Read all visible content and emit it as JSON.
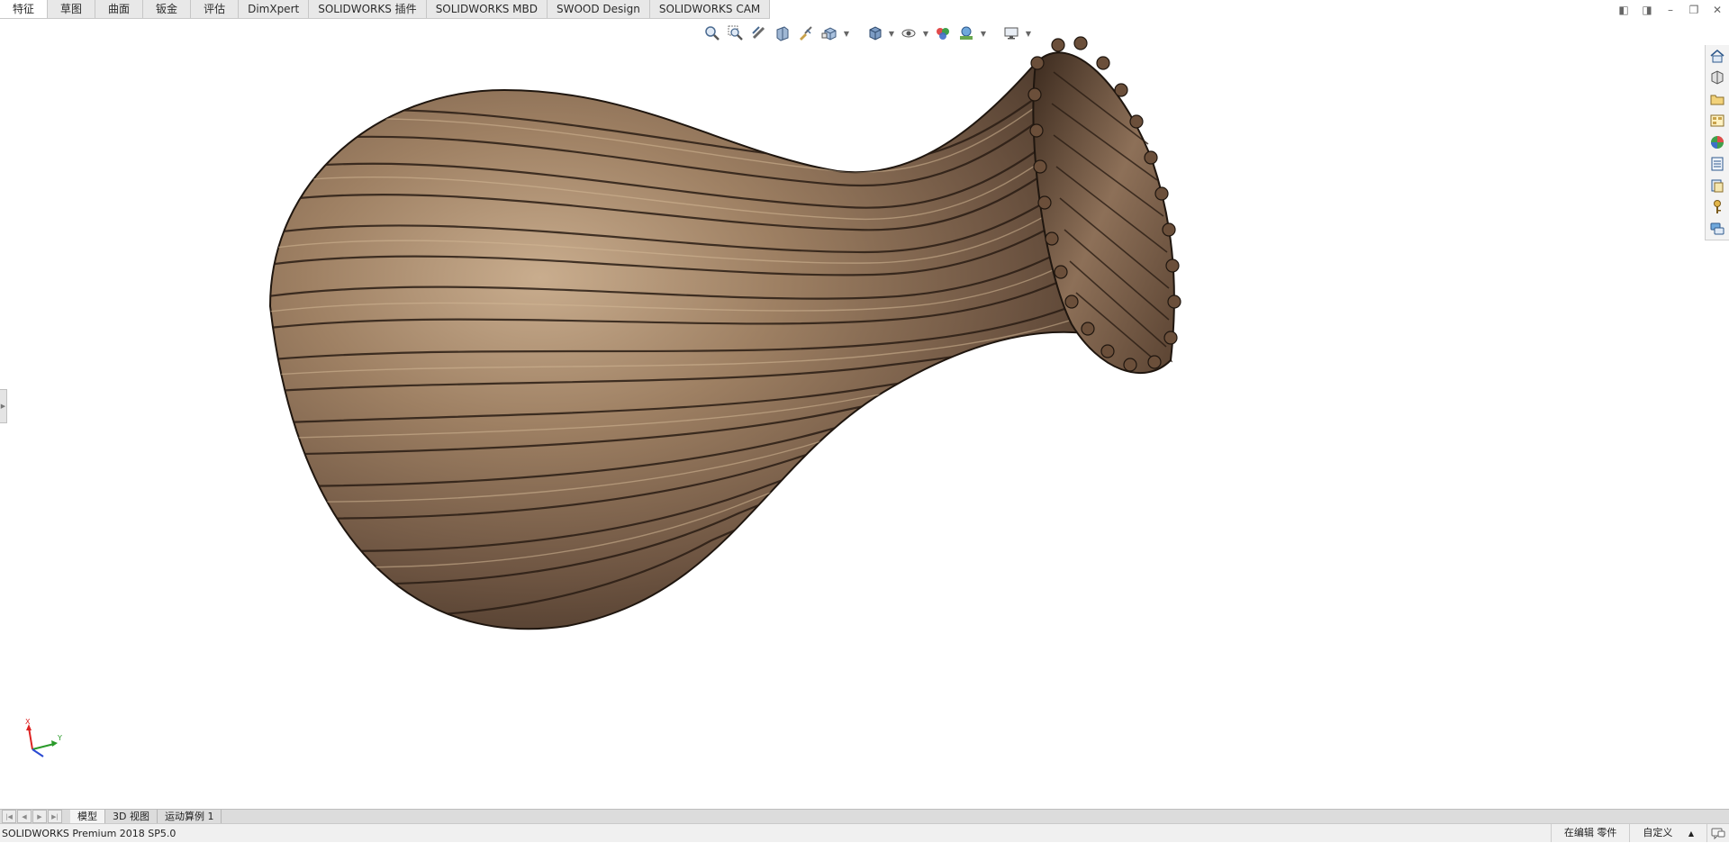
{
  "command_tabs": [
    {
      "label": "特征",
      "active": true
    },
    {
      "label": "草图"
    },
    {
      "label": "曲面"
    },
    {
      "label": "钣金"
    },
    {
      "label": "评估"
    },
    {
      "label": "DimXpert"
    },
    {
      "label": "SOLIDWORKS 插件"
    },
    {
      "label": "SOLIDWORKS MBD"
    },
    {
      "label": "SWOOD Design"
    },
    {
      "label": "SOLIDWORKS CAM"
    }
  ],
  "window_controls": {
    "restore_left": "◧",
    "restore_right": "◨",
    "minimize": "–",
    "maximize": "❐",
    "close": "✕"
  },
  "hud_icons": [
    "zoom-to-fit-icon",
    "zoom-to-area-icon",
    "previous-view-icon",
    "section-view-icon",
    "dynamic-annotation-icon",
    "view-orientation-icon",
    "display-style-icon",
    "hide-show-items-icon",
    "edit-appearance-icon",
    "apply-scene-icon",
    "view-settings-icon"
  ],
  "taskpane_icons": [
    "home-icon",
    "3d-content-icon",
    "file-explorer-icon",
    "view-palette-icon",
    "appearances-icon",
    "custom-properties-icon",
    "library-icon",
    "key-icon",
    "forum-icon"
  ],
  "triad": {
    "x_label": "X",
    "y_label": "Y"
  },
  "bottom_tabs": [
    {
      "label": "模型",
      "active": true
    },
    {
      "label": "3D 视图"
    },
    {
      "label": "运动算例 1"
    }
  ],
  "status": {
    "app_version": "SOLIDWORKS Premium 2018 SP5.0",
    "editing": "在编辑 零件",
    "units": "自定义",
    "units_arrow": "▲"
  },
  "colors": {
    "model": "#8a6d52",
    "model_dark": "#3b2a1e",
    "model_light": "#c6a887"
  }
}
